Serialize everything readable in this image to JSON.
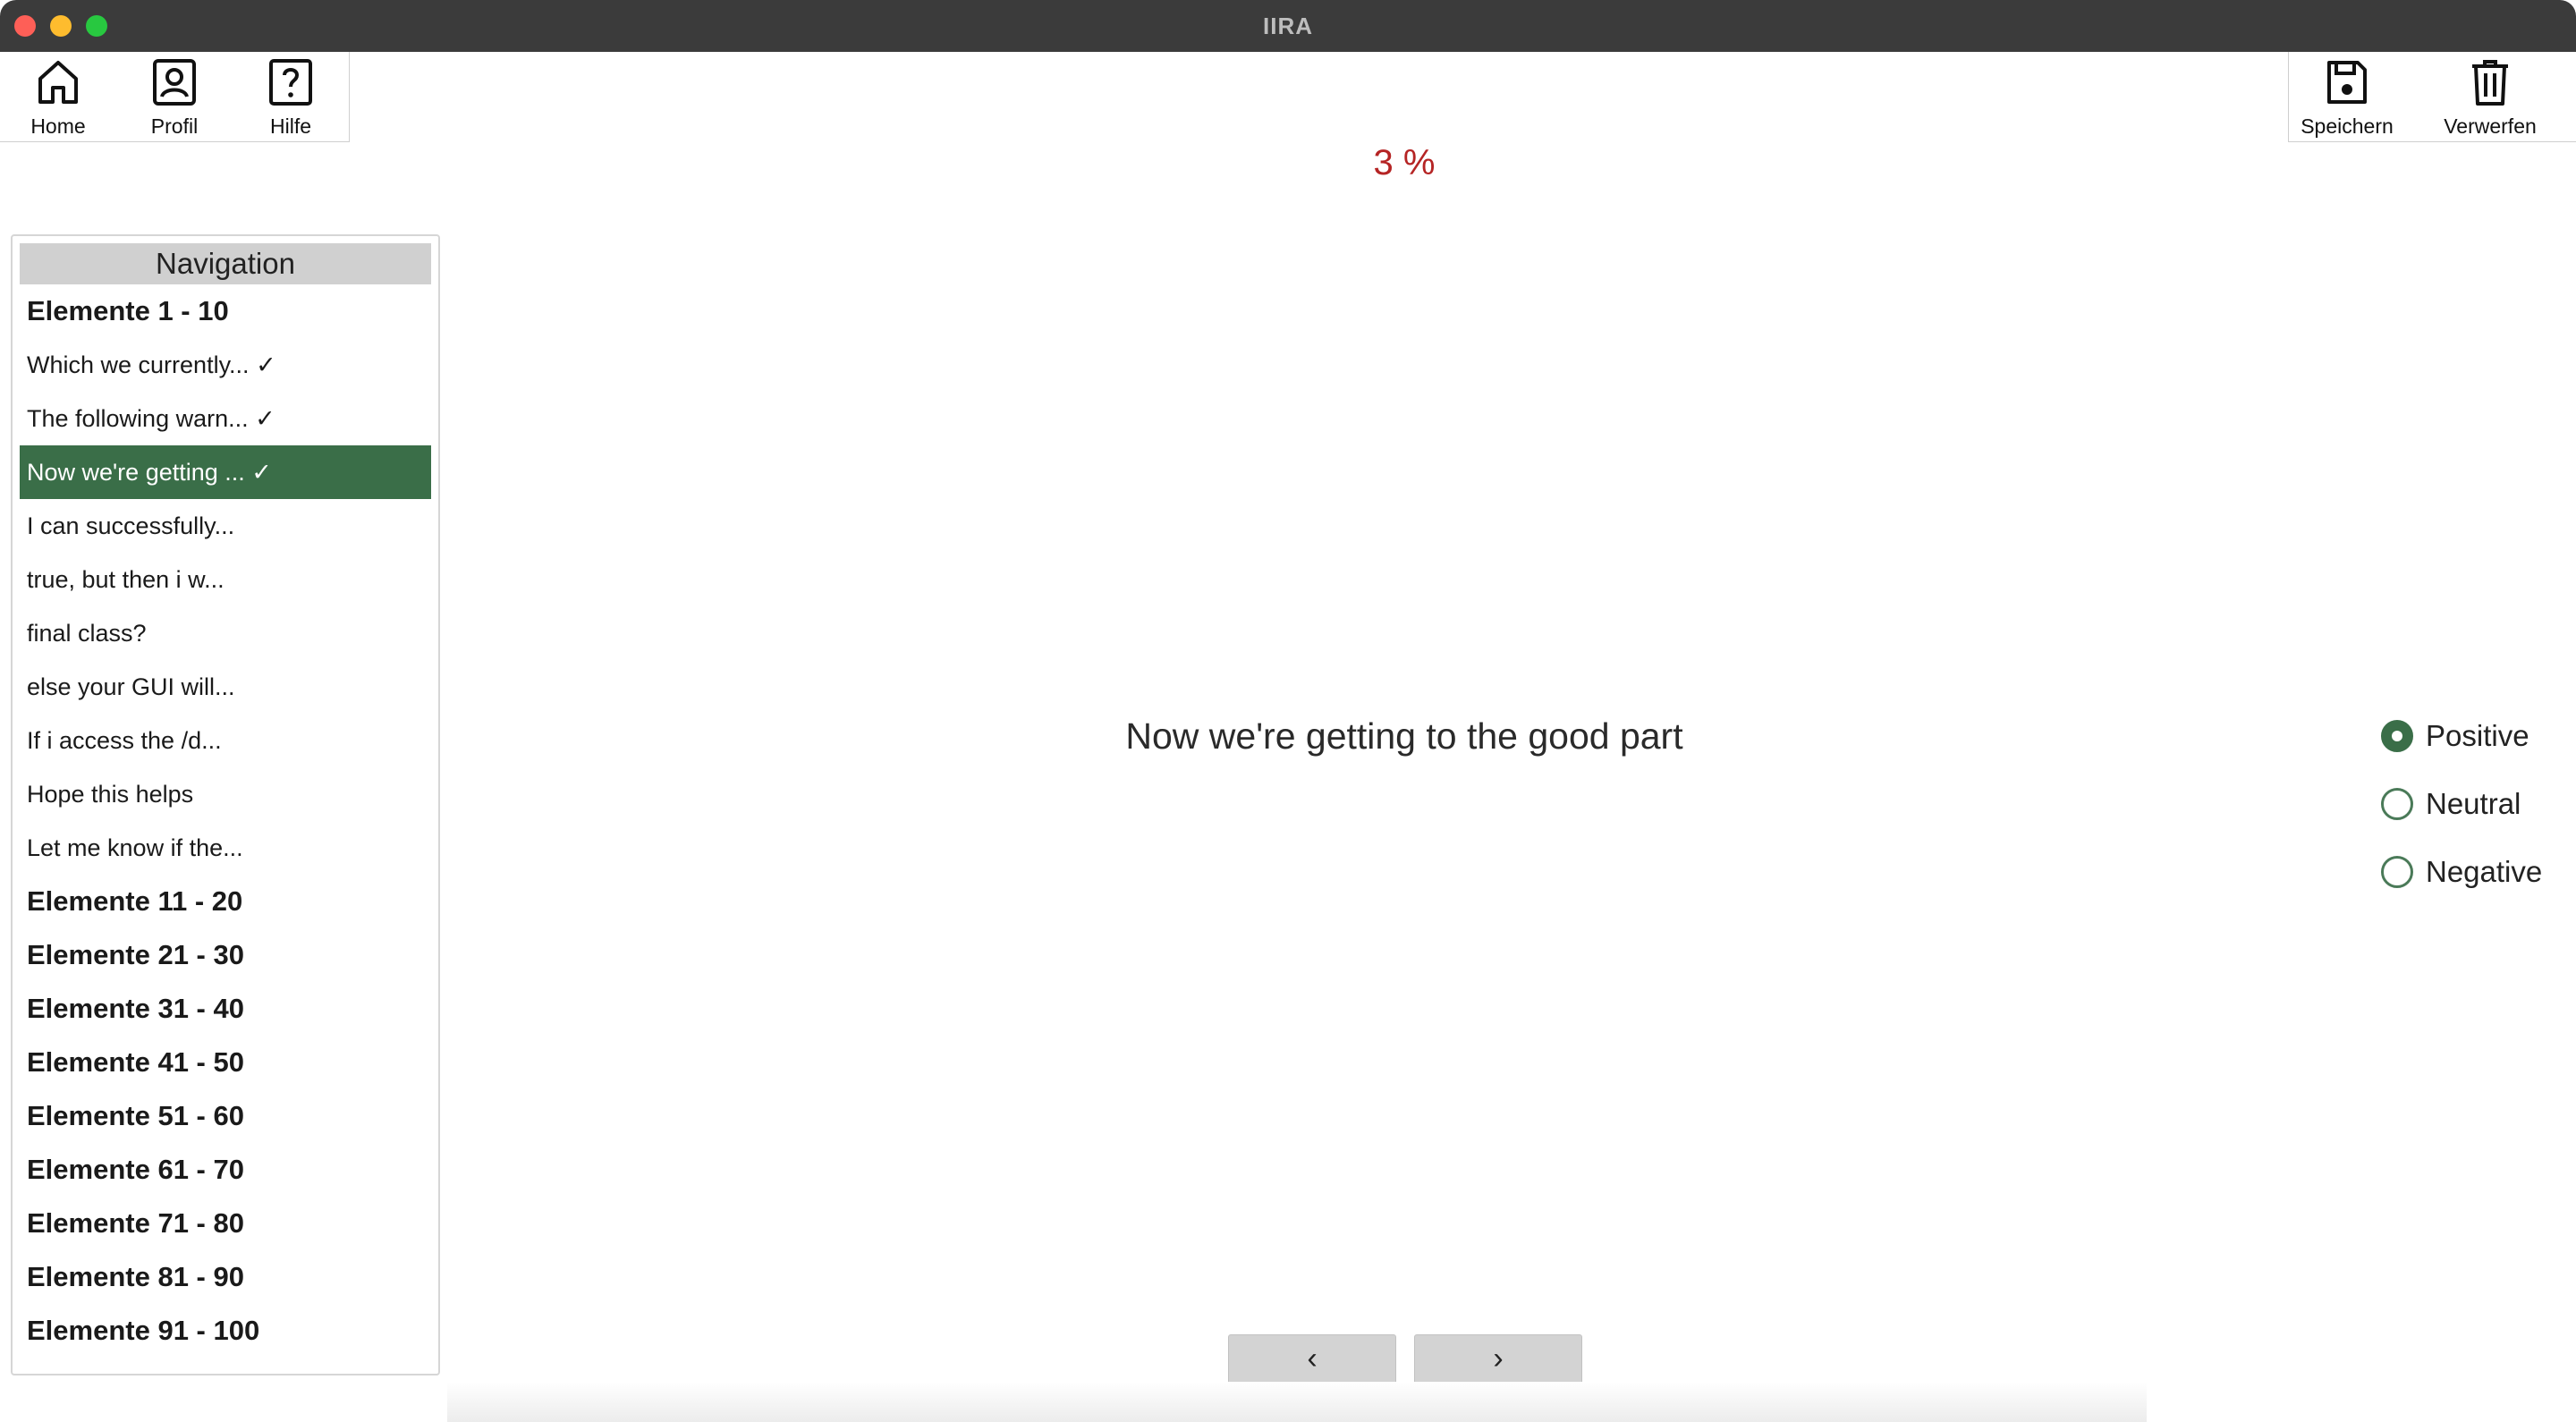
{
  "window": {
    "title": "IIRA"
  },
  "toolbar": {
    "left": [
      {
        "label": "Home",
        "icon": "home-icon"
      },
      {
        "label": "Profil",
        "icon": "profile-icon"
      },
      {
        "label": "Hilfe",
        "icon": "help-icon"
      }
    ],
    "right": [
      {
        "label": "Speichern",
        "icon": "save-icon"
      },
      {
        "label": "Verwerfen",
        "icon": "trash-icon"
      }
    ]
  },
  "progress": {
    "text": "3 %",
    "value_percent": 3,
    "color": "#b52424"
  },
  "navigation": {
    "header": "Navigation",
    "items": [
      {
        "label": "Elemente 1 - 10",
        "type": "group"
      },
      {
        "label": "Which we currently... ✓",
        "type": "item"
      },
      {
        "label": "The following warn... ✓",
        "type": "item"
      },
      {
        "label": "Now we're getting ... ✓",
        "type": "item",
        "active": true
      },
      {
        "label": "I can successfully...",
        "type": "item"
      },
      {
        "label": "true, but then i w...",
        "type": "item"
      },
      {
        "label": "final class?",
        "type": "item"
      },
      {
        "label": "else your GUI will...",
        "type": "item"
      },
      {
        "label": "If i access the /d...",
        "type": "item"
      },
      {
        "label": "Hope this helps",
        "type": "item"
      },
      {
        "label": "Let me know if the...",
        "type": "item"
      },
      {
        "label": "Elemente 11 - 20",
        "type": "group"
      },
      {
        "label": "Elemente 21 - 30",
        "type": "group"
      },
      {
        "label": "Elemente 31 - 40",
        "type": "group"
      },
      {
        "label": "Elemente 41 - 50",
        "type": "group"
      },
      {
        "label": "Elemente 51 - 60",
        "type": "group"
      },
      {
        "label": "Elemente 61 - 70",
        "type": "group"
      },
      {
        "label": "Elemente 71 - 80",
        "type": "group"
      },
      {
        "label": "Elemente 81 - 90",
        "type": "group"
      },
      {
        "label": "Elemente 91 - 100",
        "type": "group"
      }
    ]
  },
  "main": {
    "text": "Now we're getting to the good part"
  },
  "sentiment": {
    "options": [
      {
        "label": "Positive",
        "selected": true
      },
      {
        "label": "Neutral",
        "selected": false
      },
      {
        "label": "Negative",
        "selected": false
      }
    ]
  },
  "pager": {
    "prev_label": "‹",
    "next_label": "›"
  },
  "colors": {
    "accent": "#3a6e48",
    "titlebar": "#3b3b3b",
    "progress": "#b52424"
  }
}
